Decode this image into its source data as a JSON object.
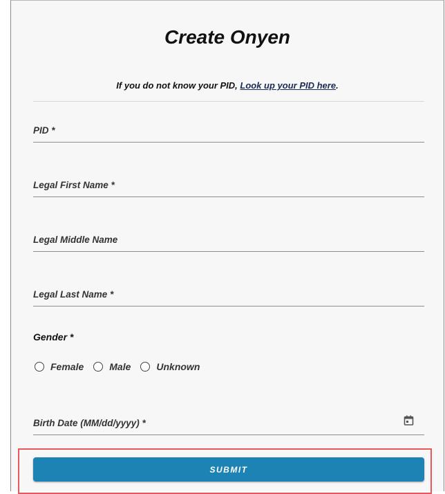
{
  "header": {
    "title": "Create Onyen",
    "help_prefix": "If you do not know your PID, ",
    "help_link": "Look up your PID here",
    "help_suffix": "."
  },
  "form": {
    "fields": [
      {
        "label": "PID *",
        "value": ""
      },
      {
        "label": "Legal First Name *",
        "value": ""
      },
      {
        "label": "Legal Middle Name",
        "value": ""
      },
      {
        "label": "Legal Last Name *",
        "value": ""
      }
    ],
    "gender": {
      "label": "Gender *",
      "options": [
        "Female",
        "Male",
        "Unknown"
      ],
      "selected": null
    },
    "birth_date": {
      "label": "Birth Date (MM/dd/yyyy) *",
      "value": "",
      "icon": "calendar-icon"
    },
    "submit_label": "SUBMIT"
  },
  "colors": {
    "submit_bg": "#1d83b5",
    "highlight_border": "#e8575b",
    "link": "#1c2a52"
  }
}
